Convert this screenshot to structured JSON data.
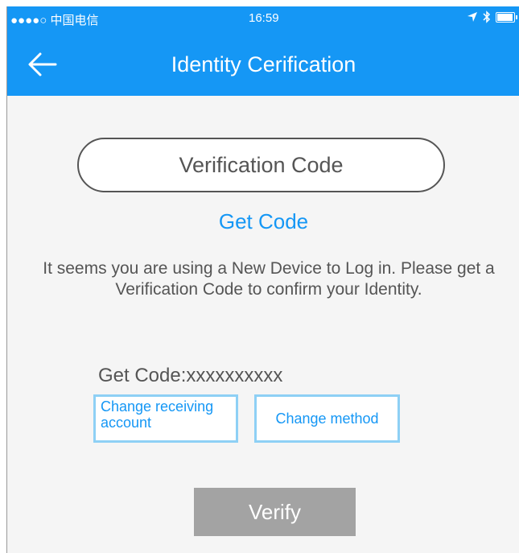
{
  "status_bar": {
    "carrier": "●●●●○ 中国电信",
    "time": "16:59",
    "location_icon": "arrow-icon",
    "bluetooth_icon": "bluetooth-icon"
  },
  "header": {
    "title": "Identity Cerification",
    "back_icon": "back-arrow-icon"
  },
  "form": {
    "code_placeholder": "Verification Code",
    "get_code_link": "Get Code",
    "info_text": "It seems you are using a New Device to Log in. Please get a Verification Code to confirm your Identity.",
    "get_code_label": "Get Code:xxxxxxxxxx",
    "change_account": "Change receiving account",
    "change_method": "Change method",
    "verify": "Verify"
  },
  "colors": {
    "accent": "#1597f5",
    "button_border": "#8ed0f5",
    "verify_bg": "#a3a3a3",
    "text": "#555555"
  }
}
